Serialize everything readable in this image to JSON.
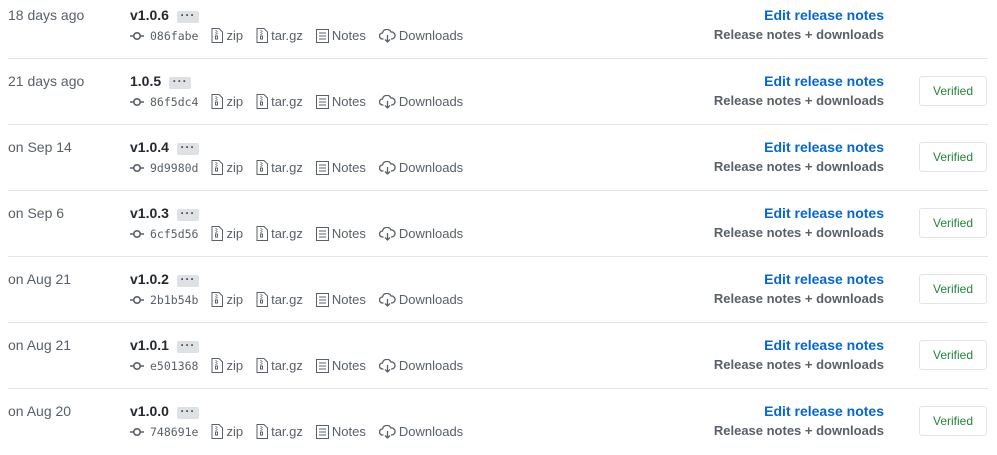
{
  "releases": [
    {
      "date": "18 days ago",
      "tag": "v1.0.6",
      "sha": "086fabe",
      "verified": ""
    },
    {
      "date": "21 days ago",
      "tag": "1.0.5",
      "sha": "86f5dc4",
      "verified": "Verified"
    },
    {
      "date": "on Sep 14",
      "tag": "v1.0.4",
      "sha": "9d9980d",
      "verified": "Verified"
    },
    {
      "date": "on Sep 6",
      "tag": "v1.0.3",
      "sha": "6cf5d56",
      "verified": "Verified"
    },
    {
      "date": "on Aug 21",
      "tag": "v1.0.2",
      "sha": "2b1b54b",
      "verified": "Verified"
    },
    {
      "date": "on Aug 21",
      "tag": "v1.0.1",
      "sha": "e501368",
      "verified": "Verified"
    },
    {
      "date": "on Aug 20",
      "tag": "v1.0.0",
      "sha": "748691e",
      "verified": "Verified"
    }
  ],
  "labels": {
    "ellipsis": "···",
    "zip": "zip",
    "targz": "tar.gz",
    "notes": "Notes",
    "downloads": "Downloads",
    "edit": "Edit release notes",
    "sub": "Release notes + downloads"
  },
  "icons": {
    "commit": "git-commit-icon",
    "zip": "file-zip-icon",
    "targz": "file-zip-icon",
    "notes": "file-text-icon",
    "downloads": "cloud-download-icon"
  },
  "colors": {
    "link": "#0366d6",
    "verified": "#22863a",
    "muted": "#586069"
  }
}
